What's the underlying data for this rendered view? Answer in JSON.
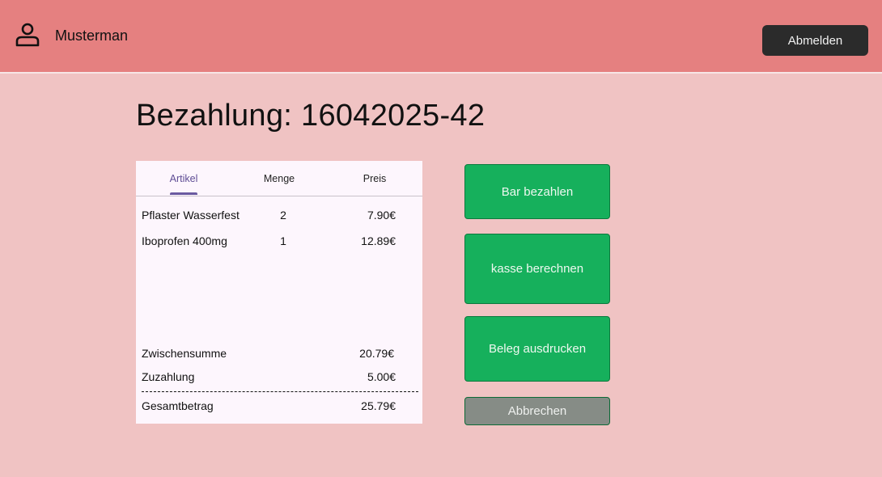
{
  "header": {
    "user_icon": "user-icon",
    "user_name": "Musterman",
    "logout_label": "Abmelden"
  },
  "page": {
    "title": "Bezahlung: 16042025-42"
  },
  "receipt": {
    "tabs": [
      {
        "label": "Artikel",
        "active": true
      },
      {
        "label": "Menge",
        "active": false
      },
      {
        "label": "Preis",
        "active": false
      }
    ],
    "items": [
      {
        "name": "Pflaster Wasserfest",
        "qty": "2",
        "price": "7.90€"
      },
      {
        "name": "Iboprofen 400mg",
        "qty": "1",
        "price": "12.89€"
      }
    ],
    "subtotal": {
      "label": "Zwischensumme",
      "value": "20.79€"
    },
    "copay": {
      "label": "Zuzahlung",
      "value": "5.00€"
    },
    "total": {
      "label": "Gesamtbetrag",
      "value": "25.79€"
    }
  },
  "actions": {
    "cash_label": "Bar bezahlen",
    "register_label": "kasse berechnen",
    "print_label": "Beleg ausdrucken",
    "cancel_label": "Abbrechen"
  },
  "colors": {
    "header_bg": "#e58080",
    "page_bg": "#f0c3c3",
    "primary_green": "#16b05c",
    "cancel_gray": "#868c86",
    "tab_accent": "#6a5aa0"
  }
}
